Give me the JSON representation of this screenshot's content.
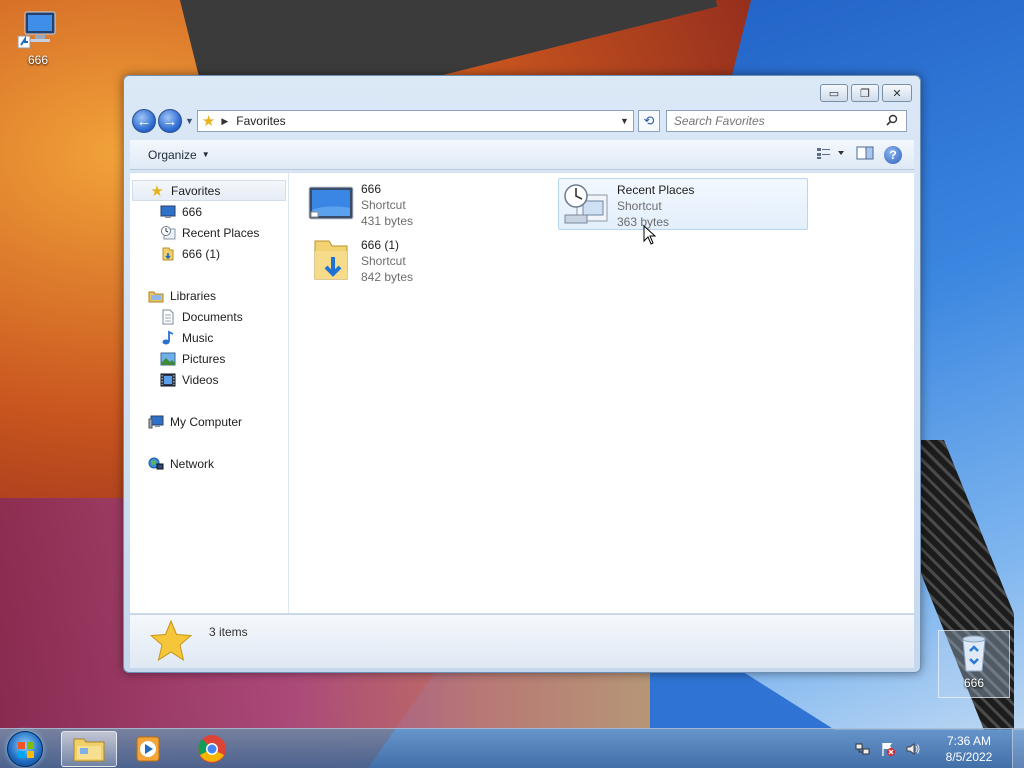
{
  "desktop": {
    "icons": [
      {
        "label": "666",
        "icon": "computer-shortcut-icon"
      },
      {
        "label": "666",
        "icon": "recycle-bin-icon"
      }
    ]
  },
  "window": {
    "controls": {
      "minimize": "▭",
      "maximize": "❐",
      "close": "✕"
    },
    "address": {
      "path": "Favorites"
    },
    "search": {
      "placeholder": "Search Favorites"
    },
    "toolbar": {
      "organize": "Organize"
    },
    "nav": {
      "favorites": {
        "label": "Favorites",
        "items": [
          {
            "label": "666",
            "icon": "monitor-icon"
          },
          {
            "label": "Recent Places",
            "icon": "recent-places-icon"
          },
          {
            "label": "666 (1)",
            "icon": "folder-shortcut-icon"
          }
        ]
      },
      "libraries": {
        "label": "Libraries",
        "items": [
          {
            "label": "Documents",
            "icon": "document-icon"
          },
          {
            "label": "Music",
            "icon": "music-note-icon"
          },
          {
            "label": "Pictures",
            "icon": "picture-icon"
          },
          {
            "label": "Videos",
            "icon": "video-icon"
          }
        ]
      },
      "computer": {
        "label": "My Computer"
      },
      "network": {
        "label": "Network"
      }
    },
    "files": [
      {
        "name": "666",
        "type": "Shortcut",
        "size": "431 bytes"
      },
      {
        "name": "Recent Places",
        "type": "Shortcut",
        "size": "363 bytes"
      },
      {
        "name": "666 (1)",
        "type": "Shortcut",
        "size": "842 bytes"
      }
    ],
    "status": {
      "count": "3 items"
    }
  },
  "taskbar": {
    "clock": {
      "time": "7:36 AM",
      "date": "8/5/2022"
    }
  },
  "colors": {
    "accent": "#2c6ad1",
    "selection": "#e3effc",
    "taskbar": "#5f8fc0"
  }
}
